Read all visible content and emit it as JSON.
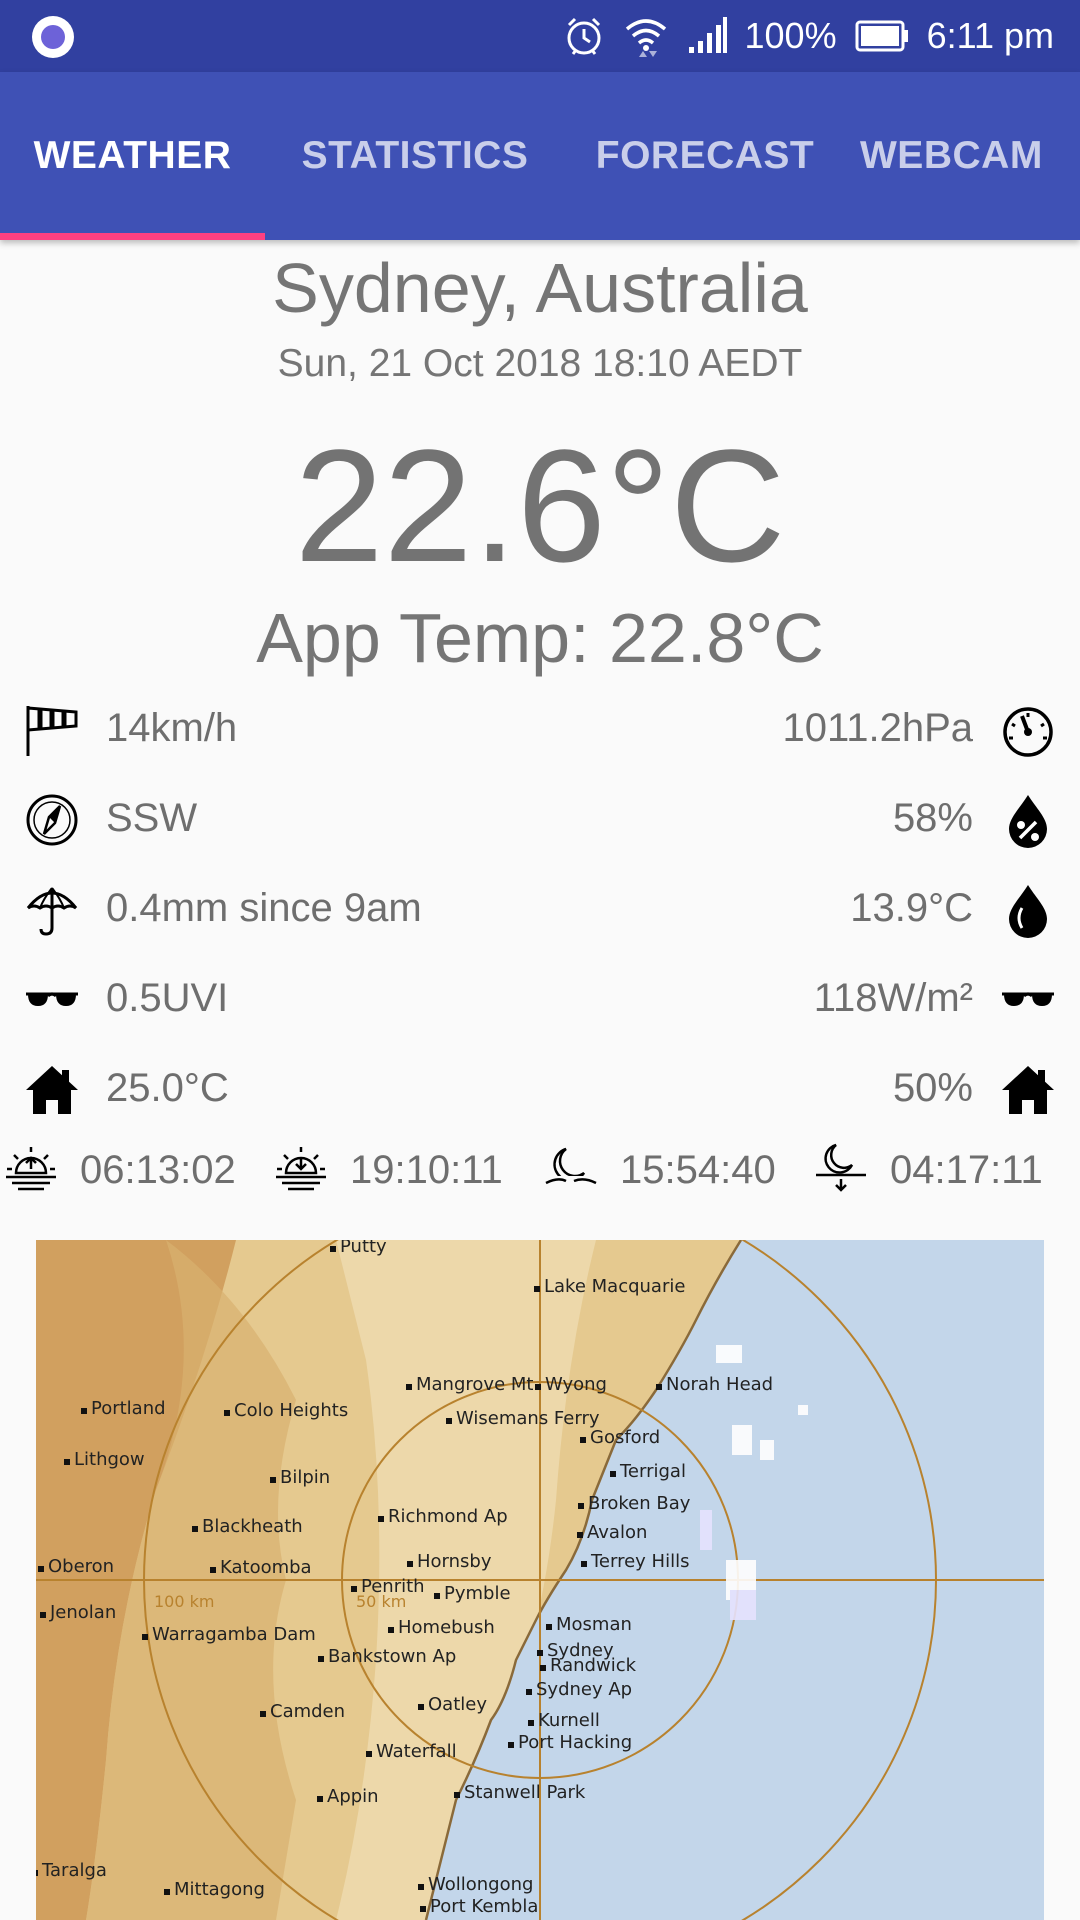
{
  "status_bar": {
    "battery": "100%",
    "time": "6:11 pm"
  },
  "tabs": [
    {
      "label": "WEATHER",
      "active": true
    },
    {
      "label": "STATISTICS",
      "active": false
    },
    {
      "label": "FORECAST",
      "active": false
    },
    {
      "label": "WEBCAM",
      "active": false
    }
  ],
  "weather": {
    "location": "Sydney, Australia",
    "datetime": "Sun, 21 Oct 2018 18:10 AEDT",
    "temperature": "22.6°C",
    "apparent_temp": "App Temp: 22.8°C",
    "rows": [
      {
        "left_icon": "windsock-icon",
        "left": "14km/h",
        "right": "1011.2hPa",
        "right_icon": "barometer-gauge-icon"
      },
      {
        "left_icon": "compass-icon",
        "left": "SSW",
        "right": "58%",
        "right_icon": "humidity-drop-icon"
      },
      {
        "left_icon": "umbrella-icon",
        "left": "0.4mm since 9am",
        "right": "13.9°C",
        "right_icon": "dewpoint-drop-icon"
      },
      {
        "left_icon": "sunglasses-icon",
        "left": "0.5UVI",
        "right": "118W/m²",
        "right_icon": "sunglasses-icon"
      },
      {
        "left_icon": "house-icon",
        "left": "25.0°C",
        "right": "50%",
        "right_icon": "house-icon"
      }
    ],
    "sun_moon": [
      {
        "icon": "sunrise-icon",
        "time": "06:13:02"
      },
      {
        "icon": "sunset-icon",
        "time": "19:10:11"
      },
      {
        "icon": "moonrise-icon",
        "time": "15:54:40"
      },
      {
        "icon": "moonset-icon",
        "time": "04:17:11"
      }
    ]
  },
  "radar_map": {
    "range_inner": "50 km",
    "range_outer": "100 km",
    "places": [
      "Putty",
      "Lake Macquarie",
      "Mangrove Mt",
      "Wyong",
      "Norah Head",
      "Portland",
      "Colo Heights",
      "Wisemans Ferry",
      "Gosford",
      "Terrigal",
      "Lithgow",
      "Bilpin",
      "Broken Bay",
      "Richmond Ap",
      "Avalon",
      "Blackheath",
      "Hornsby",
      "Terrey Hills",
      "Oberon",
      "Katoomba",
      "Penrith",
      "Pymble",
      "Jenolan",
      "Mosman",
      "Warragamba Dam",
      "Homebush",
      "Sydney",
      "Bankstown Ap",
      "Randwick",
      "Sydney Ap",
      "Camden",
      "Oatley",
      "Kurnell",
      "Waterfall",
      "Port Hacking",
      "Appin",
      "Stanwell Park",
      "Taralga",
      "Mittagong",
      "Wollongong",
      "Port Kembla"
    ]
  },
  "colors": {
    "status_bar": "#3140a0",
    "tab_bar": "#3f51b5",
    "tab_indicator": "#ff4081",
    "text": "#6e6e6e",
    "sea": "#c3d6ea",
    "land": "#e5c98f"
  }
}
